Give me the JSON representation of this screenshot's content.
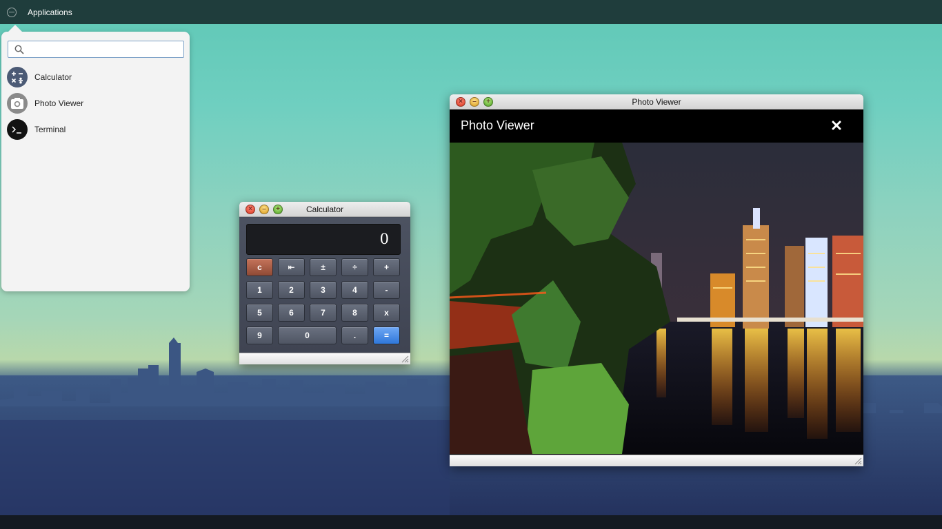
{
  "topbar": {
    "menu_label": "Applications"
  },
  "app_menu": {
    "search": {
      "placeholder": "",
      "value": ""
    },
    "items": [
      {
        "label": "Calculator",
        "icon": "calculator-icon"
      },
      {
        "label": "Photo Viewer",
        "icon": "camera-icon"
      },
      {
        "label": "Terminal",
        "icon": "terminal-icon"
      }
    ]
  },
  "calculator": {
    "title": "Calculator",
    "display": "0",
    "keys": {
      "clear": "c",
      "backspace": "⇤",
      "plus_minus": "±",
      "divide": "÷",
      "add": "+",
      "one": "1",
      "two": "2",
      "three": "3",
      "four": "4",
      "subtract": "-",
      "five": "5",
      "six": "6",
      "seven": "7",
      "eight": "8",
      "multiply": "x",
      "nine": "9",
      "zero": "0",
      "decimal": ".",
      "equals": "="
    }
  },
  "photo_viewer": {
    "window_title": "Photo Viewer",
    "header_title": "Photo Viewer",
    "toolbar": [
      "move-icon",
      "crop-icon",
      "zoom-in-icon",
      "zoom-out-icon",
      "rotate-left-icon",
      "rotate-right-icon",
      "flip-horizontal-icon",
      "flip-vertical-icon"
    ]
  },
  "colors": {
    "topbar": "#1f3d3c",
    "equals_key": "#2f77d9",
    "clear_key": "#8f4a35",
    "calc_body": "#464c5a"
  }
}
